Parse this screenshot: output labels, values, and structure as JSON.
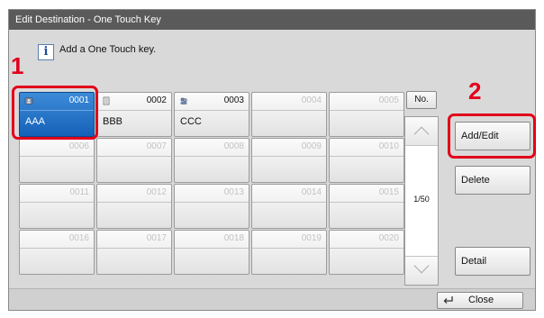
{
  "window": {
    "title": "Edit Destination - One Touch Key"
  },
  "message": {
    "icon": "info-icon",
    "text": "Add a One Touch key."
  },
  "keys": [
    {
      "num": "0001",
      "name": "AAA",
      "icon": "address-book-icon"
    },
    {
      "num": "0002",
      "name": "BBB",
      "icon": "list-icon"
    },
    {
      "num": "0003",
      "name": "CCC",
      "icon": "group-icon"
    },
    {
      "num": "0004",
      "name": ""
    },
    {
      "num": "0005",
      "name": ""
    },
    {
      "num": "0006",
      "name": ""
    },
    {
      "num": "0007",
      "name": ""
    },
    {
      "num": "0008",
      "name": ""
    },
    {
      "num": "0009",
      "name": ""
    },
    {
      "num": "0010",
      "name": ""
    },
    {
      "num": "0011",
      "name": ""
    },
    {
      "num": "0012",
      "name": ""
    },
    {
      "num": "0013",
      "name": ""
    },
    {
      "num": "0014",
      "name": ""
    },
    {
      "num": "0015",
      "name": ""
    },
    {
      "num": "0016",
      "name": ""
    },
    {
      "num": "0017",
      "name": ""
    },
    {
      "num": "0018",
      "name": ""
    },
    {
      "num": "0019",
      "name": ""
    },
    {
      "num": "0020",
      "name": ""
    }
  ],
  "selected_key": "0001",
  "sort": {
    "label": "No."
  },
  "pager": {
    "page": "1/50"
  },
  "buttons": {
    "add_edit": "Add/Edit",
    "delete": "Delete",
    "detail": "Detail",
    "close": "Close"
  },
  "callouts": {
    "step1": "1",
    "step2": "2"
  },
  "colors": {
    "selected": "#1a6bc4",
    "highlight": "#e2001a",
    "titlebar": "#5a5a5a"
  }
}
